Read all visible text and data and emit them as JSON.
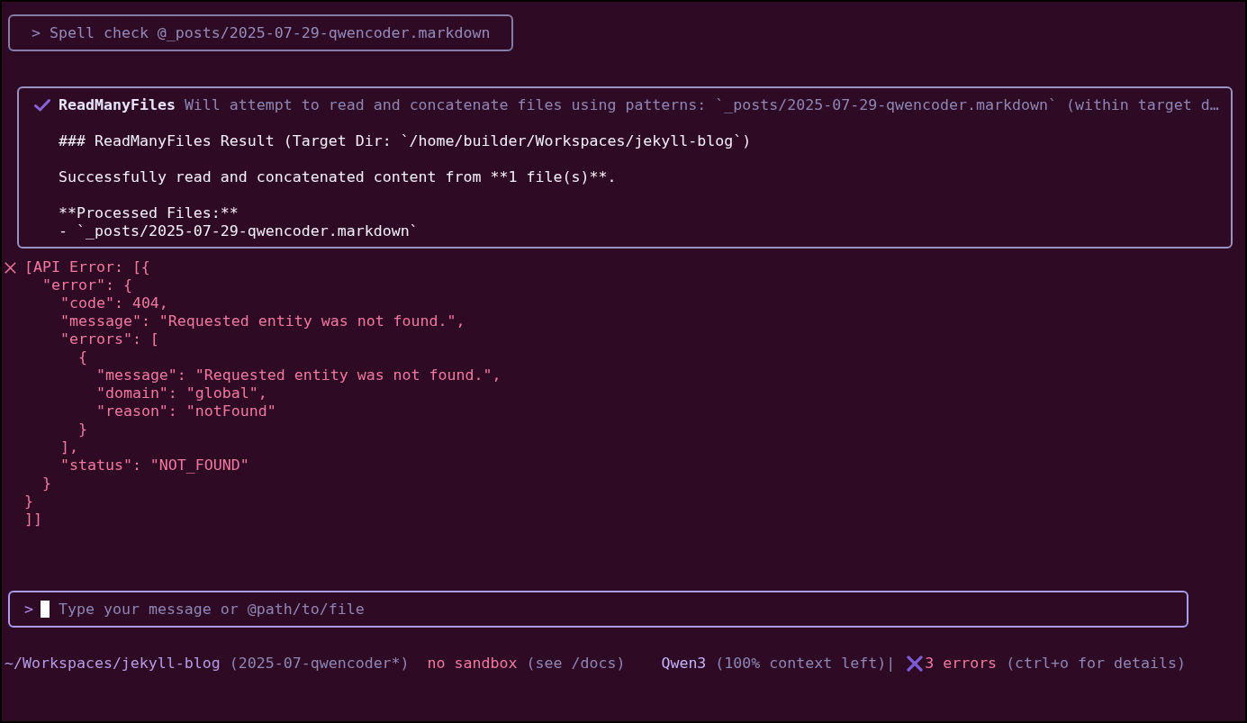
{
  "user_message": {
    "text": "> Spell check @_posts/2025-07-29-qwencoder.markdown"
  },
  "tool_call": {
    "succeeded": true,
    "name": "ReadManyFiles",
    "description": "Will attempt to read and concatenate files using patterns: `_posts/2025-07-29-qwencoder.markdown` (within target d…",
    "output": [
      [
        "### ReadManyFiles Result (Target Dir: `/home/builder/Workspaces/jekyll-blog`)"
      ],
      [
        "Successfully read and concatenated content from **1 file(s)**."
      ],
      [
        "**Processed Files:**",
        "- `_posts/2025-07-29-qwencoder.markdown`"
      ]
    ]
  },
  "error": {
    "lines": [
      "[API Error: [{",
      "  \"error\": {",
      "    \"code\": 404,",
      "    \"message\": \"Requested entity was not found.\",",
      "    \"errors\": [",
      "      {",
      "        \"message\": \"Requested entity was not found.\",",
      "        \"domain\": \"global\",",
      "        \"reason\": \"notFound\"",
      "      }",
      "    ],",
      "    \"status\": \"NOT_FOUND\"",
      "  }",
      "}",
      "]]"
    ]
  },
  "input": {
    "prompt": ">",
    "placeholder": "Type your message or @path/to/file"
  },
  "status_bar": {
    "path": "~/Workspaces/jekyll-blog",
    "branch": "(2025-07-qwencoder*)",
    "sandbox": "no sandbox",
    "sandbox_hint": "(see /docs)",
    "model": "Qwen3",
    "context": "(100% context left)",
    "separator": "|",
    "errors": "3 errors",
    "errors_hint": "(ctrl+o for details)"
  }
}
